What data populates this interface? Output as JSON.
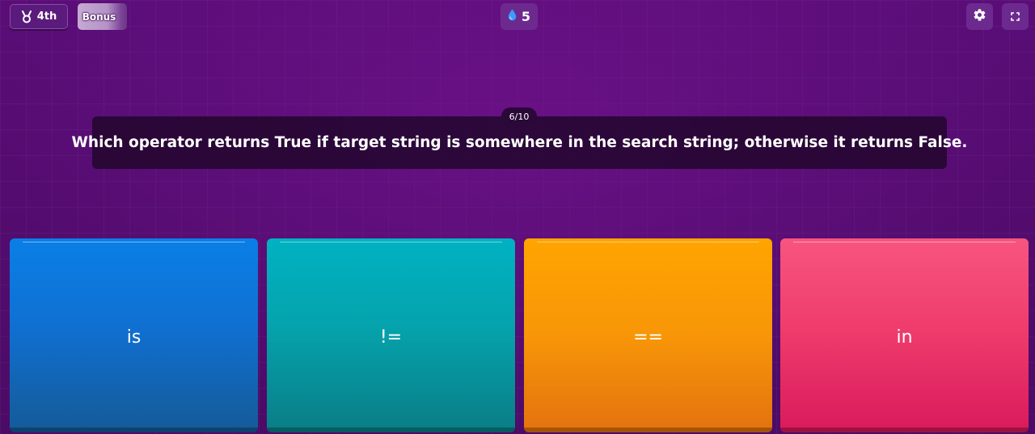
{
  "header": {
    "rank": "4th",
    "rank_icon": "medal-icon",
    "bonus_label": "Bonus",
    "streak_count": "5",
    "streak_icon": "water-drop-icon",
    "settings_icon": "gear-icon",
    "fullscreen_icon": "expand-icon"
  },
  "question": {
    "counter": "6/10",
    "text": "Which operator returns True if target string is somewhere in the search string; otherwise it returns False."
  },
  "answers": [
    {
      "label": "is",
      "color": "#1070d2"
    },
    {
      "label": "!=",
      "color": "#05a3ad"
    },
    {
      "label": "==",
      "color": "#f89608"
    },
    {
      "label": "in",
      "color": "#ef3d6d"
    }
  ],
  "colors": {
    "background": "#4c0b66",
    "question_box": "#20062a",
    "pill": "#6d2a8e"
  }
}
